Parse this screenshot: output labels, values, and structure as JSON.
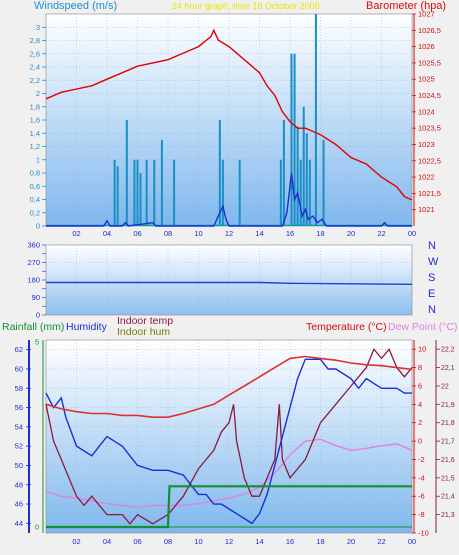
{
  "header": {
    "left_label": "Windspeed (m/s)",
    "center_label": "24 hour graph, time 18 October 2008",
    "right_label": "Barometer (hpa)"
  },
  "legend": {
    "rainfall": "Rainfall (mm)",
    "humidity": "Humidity",
    "indoor_temp": "Indoor temp",
    "indoor_hum": "Indoor hum",
    "temperature": "Temperature (°C)",
    "dew_point": "Dew Point (°C)"
  },
  "compass": [
    "N",
    "W",
    "S",
    "E",
    "N"
  ],
  "colors": {
    "wind": "#1a8fc4",
    "barometer": "#e00000",
    "direction": "#2040d0",
    "humidity": "#1a2fd0",
    "indoor_temp": "#8b1a3a",
    "indoor_hum": "#7b7b00",
    "temperature": "#e03030",
    "dew_point": "#e080e0",
    "rain": "#109030"
  },
  "chart_data": [
    {
      "type": "line",
      "name": "wind-barometer",
      "x_ticks": [
        "02",
        "04",
        "06",
        "08",
        "10",
        "12",
        "14",
        "16",
        "18",
        "20",
        "22",
        "00"
      ],
      "xlim": [
        0,
        24
      ],
      "ylim_left": [
        0,
        3.2
      ],
      "yticks_left": [
        "0",
        "0,2",
        "0,4",
        "0,6",
        "0,8",
        "1",
        "1,2",
        "1,4",
        "1,6",
        "1,8",
        "2",
        "2,2",
        "2,4",
        "2,6",
        "2,8",
        "3"
      ],
      "ylim_right": [
        1020.5,
        1027
      ],
      "yticks_right": [
        "1021",
        "1021,5",
        "1022",
        "1022,5",
        "1023",
        "1023,5",
        "1024",
        "1024,5",
        "1025",
        "1025,5",
        "1026",
        "1026,5",
        "1027"
      ],
      "gust_bars": [
        {
          "x": 4.5,
          "v": 1.0
        },
        {
          "x": 4.7,
          "v": 0.9
        },
        {
          "x": 5.3,
          "v": 1.6
        },
        {
          "x": 5.8,
          "v": 1.0
        },
        {
          "x": 6.0,
          "v": 1.0
        },
        {
          "x": 6.2,
          "v": 0.8
        },
        {
          "x": 6.6,
          "v": 1.0
        },
        {
          "x": 7.1,
          "v": 1.0
        },
        {
          "x": 7.6,
          "v": 1.3
        },
        {
          "x": 8.4,
          "v": 1.0
        },
        {
          "x": 11.4,
          "v": 1.6
        },
        {
          "x": 11.6,
          "v": 1.0
        },
        {
          "x": 12.7,
          "v": 1.0
        },
        {
          "x": 15.4,
          "v": 1.0
        },
        {
          "x": 15.6,
          "v": 1.6
        },
        {
          "x": 16.1,
          "v": 2.6
        },
        {
          "x": 16.3,
          "v": 2.6
        },
        {
          "x": 16.5,
          "v": 1.5
        },
        {
          "x": 16.7,
          "v": 1.0
        },
        {
          "x": 16.9,
          "v": 1.8
        },
        {
          "x": 17.1,
          "v": 1.4
        },
        {
          "x": 17.3,
          "v": 1.0
        },
        {
          "x": 17.7,
          "v": 3.2
        },
        {
          "x": 18.2,
          "v": 1.3
        }
      ],
      "wind_avg": [
        [
          0,
          0
        ],
        [
          3.8,
          0
        ],
        [
          4.0,
          0.08
        ],
        [
          4.2,
          0
        ],
        [
          5.0,
          0
        ],
        [
          5.2,
          0.05
        ],
        [
          5.4,
          0
        ],
        [
          7.0,
          0.05
        ],
        [
          7.2,
          0
        ],
        [
          11.0,
          0
        ],
        [
          11.3,
          0.15
        ],
        [
          11.6,
          0.3
        ],
        [
          11.8,
          0.1
        ],
        [
          12.0,
          0
        ],
        [
          15.5,
          0
        ],
        [
          15.8,
          0.2
        ],
        [
          16.1,
          0.8
        ],
        [
          16.3,
          0.4
        ],
        [
          16.5,
          0.5
        ],
        [
          16.8,
          0.15
        ],
        [
          17.0,
          0.25
        ],
        [
          17.2,
          0.1
        ],
        [
          17.5,
          0.15
        ],
        [
          17.8,
          0.05
        ],
        [
          18.1,
          0.1
        ],
        [
          18.4,
          0
        ],
        [
          22.0,
          0
        ],
        [
          22.2,
          0.05
        ],
        [
          22.4,
          0
        ],
        [
          24,
          0
        ]
      ],
      "barometer": [
        [
          0,
          1024.4
        ],
        [
          1,
          1024.6
        ],
        [
          2,
          1024.7
        ],
        [
          3,
          1024.8
        ],
        [
          4,
          1025.0
        ],
        [
          5,
          1025.2
        ],
        [
          6,
          1025.4
        ],
        [
          7,
          1025.5
        ],
        [
          8,
          1025.6
        ],
        [
          9,
          1025.8
        ],
        [
          10,
          1026.0
        ],
        [
          10.8,
          1026.3
        ],
        [
          11,
          1026.5
        ],
        [
          11.3,
          1026.2
        ],
        [
          12,
          1026.0
        ],
        [
          13,
          1025.6
        ],
        [
          14,
          1025.2
        ],
        [
          14.5,
          1024.8
        ],
        [
          15,
          1024.5
        ],
        [
          15.5,
          1024.0
        ],
        [
          16,
          1023.7
        ],
        [
          16.5,
          1023.5
        ],
        [
          17,
          1023.5
        ],
        [
          17.5,
          1023.4
        ],
        [
          18,
          1023.3
        ],
        [
          19,
          1023.0
        ],
        [
          20,
          1022.6
        ],
        [
          21,
          1022.4
        ],
        [
          22,
          1022.0
        ],
        [
          23,
          1021.7
        ],
        [
          23.5,
          1021.4
        ],
        [
          24,
          1021.3
        ]
      ]
    },
    {
      "type": "line",
      "name": "wind-direction",
      "xlim": [
        0,
        24
      ],
      "ylim": [
        0,
        360
      ],
      "yticks": [
        "0",
        "45",
        "90",
        "135",
        "180",
        "225",
        "270",
        "315",
        "360"
      ],
      "direction": [
        [
          0,
          167
        ],
        [
          14,
          167
        ],
        [
          16,
          163
        ],
        [
          24,
          158
        ]
      ]
    },
    {
      "type": "line",
      "name": "humidity-temperature",
      "x_ticks": [
        "02",
        "04",
        "06",
        "08",
        "10",
        "12",
        "14",
        "16",
        "18",
        "20",
        "22",
        "00"
      ],
      "xlim": [
        0,
        24
      ],
      "ylim_humidity": [
        43,
        63
      ],
      "yticks_humidity": [
        "44",
        "46",
        "48",
        "50",
        "52",
        "54",
        "56",
        "58",
        "60",
        "62"
      ],
      "ylim_rain": [
        0,
        5
      ],
      "yticks_rain": [
        "0",
        "5"
      ],
      "ylim_temp": [
        -10,
        11
      ],
      "yticks_temp": [
        "-10",
        "-8",
        "-6",
        "-4",
        "-2",
        "0",
        "2",
        "4",
        "6",
        "8",
        "10"
      ],
      "ylim_indoor": [
        21.2,
        22.25
      ],
      "yticks_indoor": [
        "21,3",
        "21,4",
        "21,5",
        "21,6",
        "21,7",
        "21,8",
        "21,9",
        "22",
        "22,1",
        "22,2"
      ],
      "humidity": [
        [
          0,
          57.5
        ],
        [
          0.5,
          56
        ],
        [
          1,
          57
        ],
        [
          1.3,
          55
        ],
        [
          2,
          52
        ],
        [
          3,
          51
        ],
        [
          3.5,
          52
        ],
        [
          4,
          53
        ],
        [
          4.5,
          52.5
        ],
        [
          5,
          52
        ],
        [
          5.5,
          51
        ],
        [
          6,
          50
        ],
        [
          7,
          49.5
        ],
        [
          8,
          49.5
        ],
        [
          9,
          49
        ],
        [
          9.5,
          48
        ],
        [
          10,
          47
        ],
        [
          10.5,
          47
        ],
        [
          11,
          46
        ],
        [
          11.5,
          46
        ],
        [
          12,
          45.5
        ],
        [
          12.5,
          45
        ],
        [
          13,
          44.5
        ],
        [
          13.5,
          44
        ],
        [
          14,
          45
        ],
        [
          14.5,
          47
        ],
        [
          15,
          50
        ],
        [
          15.5,
          53
        ],
        [
          16,
          56
        ],
        [
          16.5,
          59
        ],
        [
          17,
          61
        ],
        [
          18,
          61
        ],
        [
          18.5,
          60
        ],
        [
          19,
          60
        ],
        [
          20,
          59
        ],
        [
          20.5,
          58
        ],
        [
          21,
          59
        ],
        [
          22,
          58
        ],
        [
          23,
          58
        ],
        [
          23.5,
          57.5
        ],
        [
          24,
          57.5
        ]
      ],
      "indoor_temp": [
        [
          0,
          21.9
        ],
        [
          0.5,
          21.7
        ],
        [
          1,
          21.6
        ],
        [
          1.5,
          21.5
        ],
        [
          2,
          21.4
        ],
        [
          2.5,
          21.35
        ],
        [
          3,
          21.4
        ],
        [
          3.5,
          21.35
        ],
        [
          4,
          21.3
        ],
        [
          5,
          21.3
        ],
        [
          5.5,
          21.25
        ],
        [
          6,
          21.3
        ],
        [
          7,
          21.25
        ],
        [
          8,
          21.3
        ],
        [
          9,
          21.4
        ],
        [
          10,
          21.55
        ],
        [
          11,
          21.65
        ],
        [
          11.5,
          21.75
        ],
        [
          12,
          21.8
        ],
        [
          12.3,
          21.9
        ],
        [
          12.5,
          21.7
        ],
        [
          13,
          21.5
        ],
        [
          13.5,
          21.4
        ],
        [
          14,
          21.4
        ],
        [
          14.5,
          21.5
        ],
        [
          15,
          21.6
        ],
        [
          15.3,
          21.9
        ],
        [
          15.5,
          21.6
        ],
        [
          16,
          21.5
        ],
        [
          17,
          21.6
        ],
        [
          17.5,
          21.7
        ],
        [
          18,
          21.8
        ],
        [
          19,
          21.9
        ],
        [
          20,
          22.0
        ],
        [
          21,
          22.1
        ],
        [
          21.5,
          22.2
        ],
        [
          22,
          22.15
        ],
        [
          22.5,
          22.2
        ],
        [
          23,
          22.1
        ],
        [
          23.5,
          22.05
        ],
        [
          24,
          22.1
        ]
      ],
      "temperature": [
        [
          0,
          4.0
        ],
        [
          1,
          3.5
        ],
        [
          2,
          3.2
        ],
        [
          3,
          3.0
        ],
        [
          4,
          3.0
        ],
        [
          5,
          2.8
        ],
        [
          6,
          2.8
        ],
        [
          7,
          2.6
        ],
        [
          8,
          2.6
        ],
        [
          9,
          3.0
        ],
        [
          10,
          3.5
        ],
        [
          11,
          4.0
        ],
        [
          12,
          5.0
        ],
        [
          13,
          6.0
        ],
        [
          14,
          7.0
        ],
        [
          15,
          8.0
        ],
        [
          16,
          9.0
        ],
        [
          17,
          9.2
        ],
        [
          18,
          9.0
        ],
        [
          19,
          8.8
        ],
        [
          20,
          8.5
        ],
        [
          21,
          8.3
        ],
        [
          22,
          8.2
        ],
        [
          23,
          8.0
        ],
        [
          24,
          7.8
        ]
      ],
      "dew_point": [
        [
          0,
          -5.5
        ],
        [
          1,
          -6.0
        ],
        [
          2,
          -6.2
        ],
        [
          3,
          -6.5
        ],
        [
          4,
          -6.8
        ],
        [
          5,
          -7.0
        ],
        [
          6,
          -7.2
        ],
        [
          7,
          -7.0
        ],
        [
          8,
          -7.0
        ],
        [
          9,
          -7.0
        ],
        [
          10,
          -6.8
        ],
        [
          11,
          -6.5
        ],
        [
          12,
          -6.2
        ],
        [
          13,
          -5.8
        ],
        [
          14,
          -5.0
        ],
        [
          15,
          -3.5
        ],
        [
          16,
          -1.5
        ],
        [
          17,
          0
        ],
        [
          18,
          0.2
        ],
        [
          19,
          -0.5
        ],
        [
          20,
          -1.0
        ],
        [
          21,
          -0.8
        ],
        [
          22,
          -0.5
        ],
        [
          23,
          -0.3
        ],
        [
          24,
          -1.0
        ]
      ],
      "rainfall": [
        [
          0,
          0
        ],
        [
          24,
          0
        ]
      ],
      "rain_step": [
        [
          0,
          0
        ],
        [
          8,
          0
        ],
        [
          8.1,
          1.1
        ],
        [
          24,
          1.1
        ]
      ]
    }
  ]
}
